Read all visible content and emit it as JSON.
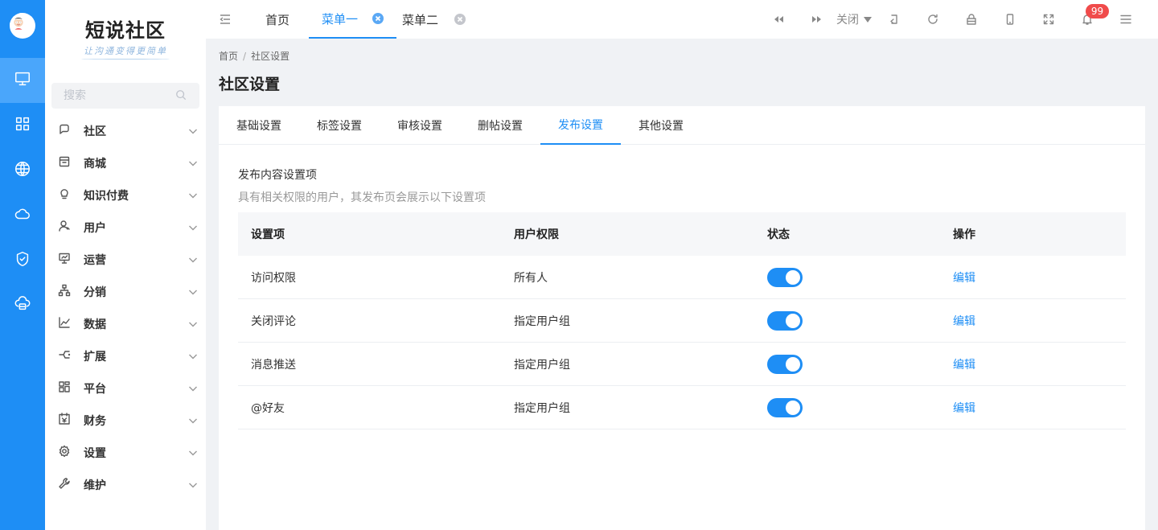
{
  "sidebar": {
    "logo_title": "短说社区",
    "logo_sub": "让沟通变得更简单",
    "search_placeholder": "搜索",
    "items": [
      {
        "label": "社区",
        "icon": "chat-bubble-icon"
      },
      {
        "label": "商城",
        "icon": "store-icon"
      },
      {
        "label": "知识付费",
        "icon": "lightbulb-icon"
      },
      {
        "label": "用户",
        "icon": "user-icon"
      },
      {
        "label": "运营",
        "icon": "presentation-icon"
      },
      {
        "label": "分销",
        "icon": "hierarchy-icon"
      },
      {
        "label": "数据",
        "icon": "line-chart-icon"
      },
      {
        "label": "扩展",
        "icon": "extension-icon"
      },
      {
        "label": "平台",
        "icon": "platform-icon"
      },
      {
        "label": "财务",
        "icon": "finance-icon"
      },
      {
        "label": "设置",
        "icon": "gear-icon"
      },
      {
        "label": "维护",
        "icon": "wrench-icon"
      }
    ]
  },
  "rail": {
    "items": [
      "monitor-icon",
      "grid-icon",
      "globe-icon",
      "cloud-icon",
      "shield-check-icon",
      "cloud-server-icon"
    ]
  },
  "topbar": {
    "tabs": [
      {
        "label": "首页"
      },
      {
        "label": "菜单一"
      },
      {
        "label": "菜单二"
      }
    ],
    "close_label": "关闭",
    "notification_count": "99"
  },
  "breadcrumb": {
    "home": "首页",
    "separator": "/",
    "current": "社区设置"
  },
  "page": {
    "title": "社区设置"
  },
  "settings_tabs": [
    {
      "label": "基础设置"
    },
    {
      "label": "标签设置"
    },
    {
      "label": "审核设置"
    },
    {
      "label": "删帖设置"
    },
    {
      "label": "发布设置"
    },
    {
      "label": "其他设置"
    }
  ],
  "section": {
    "title": "发布内容设置项",
    "description": "具有相关权限的用户，其发布页会展示以下设置项"
  },
  "table": {
    "headers": [
      "设置项",
      "用户权限",
      "状态",
      "操作"
    ],
    "rows": [
      {
        "item": "访问权限",
        "permission": "所有人",
        "enabled": true,
        "action": "编辑"
      },
      {
        "item": "关闭评论",
        "permission": "指定用户组",
        "enabled": true,
        "action": "编辑"
      },
      {
        "item": "消息推送",
        "permission": "指定用户组",
        "enabled": true,
        "action": "编辑"
      },
      {
        "item": "@好友",
        "permission": "指定用户组",
        "enabled": true,
        "action": "编辑"
      }
    ]
  },
  "colors": {
    "accent": "#1e8ef5",
    "badge": "#f04b4b"
  }
}
